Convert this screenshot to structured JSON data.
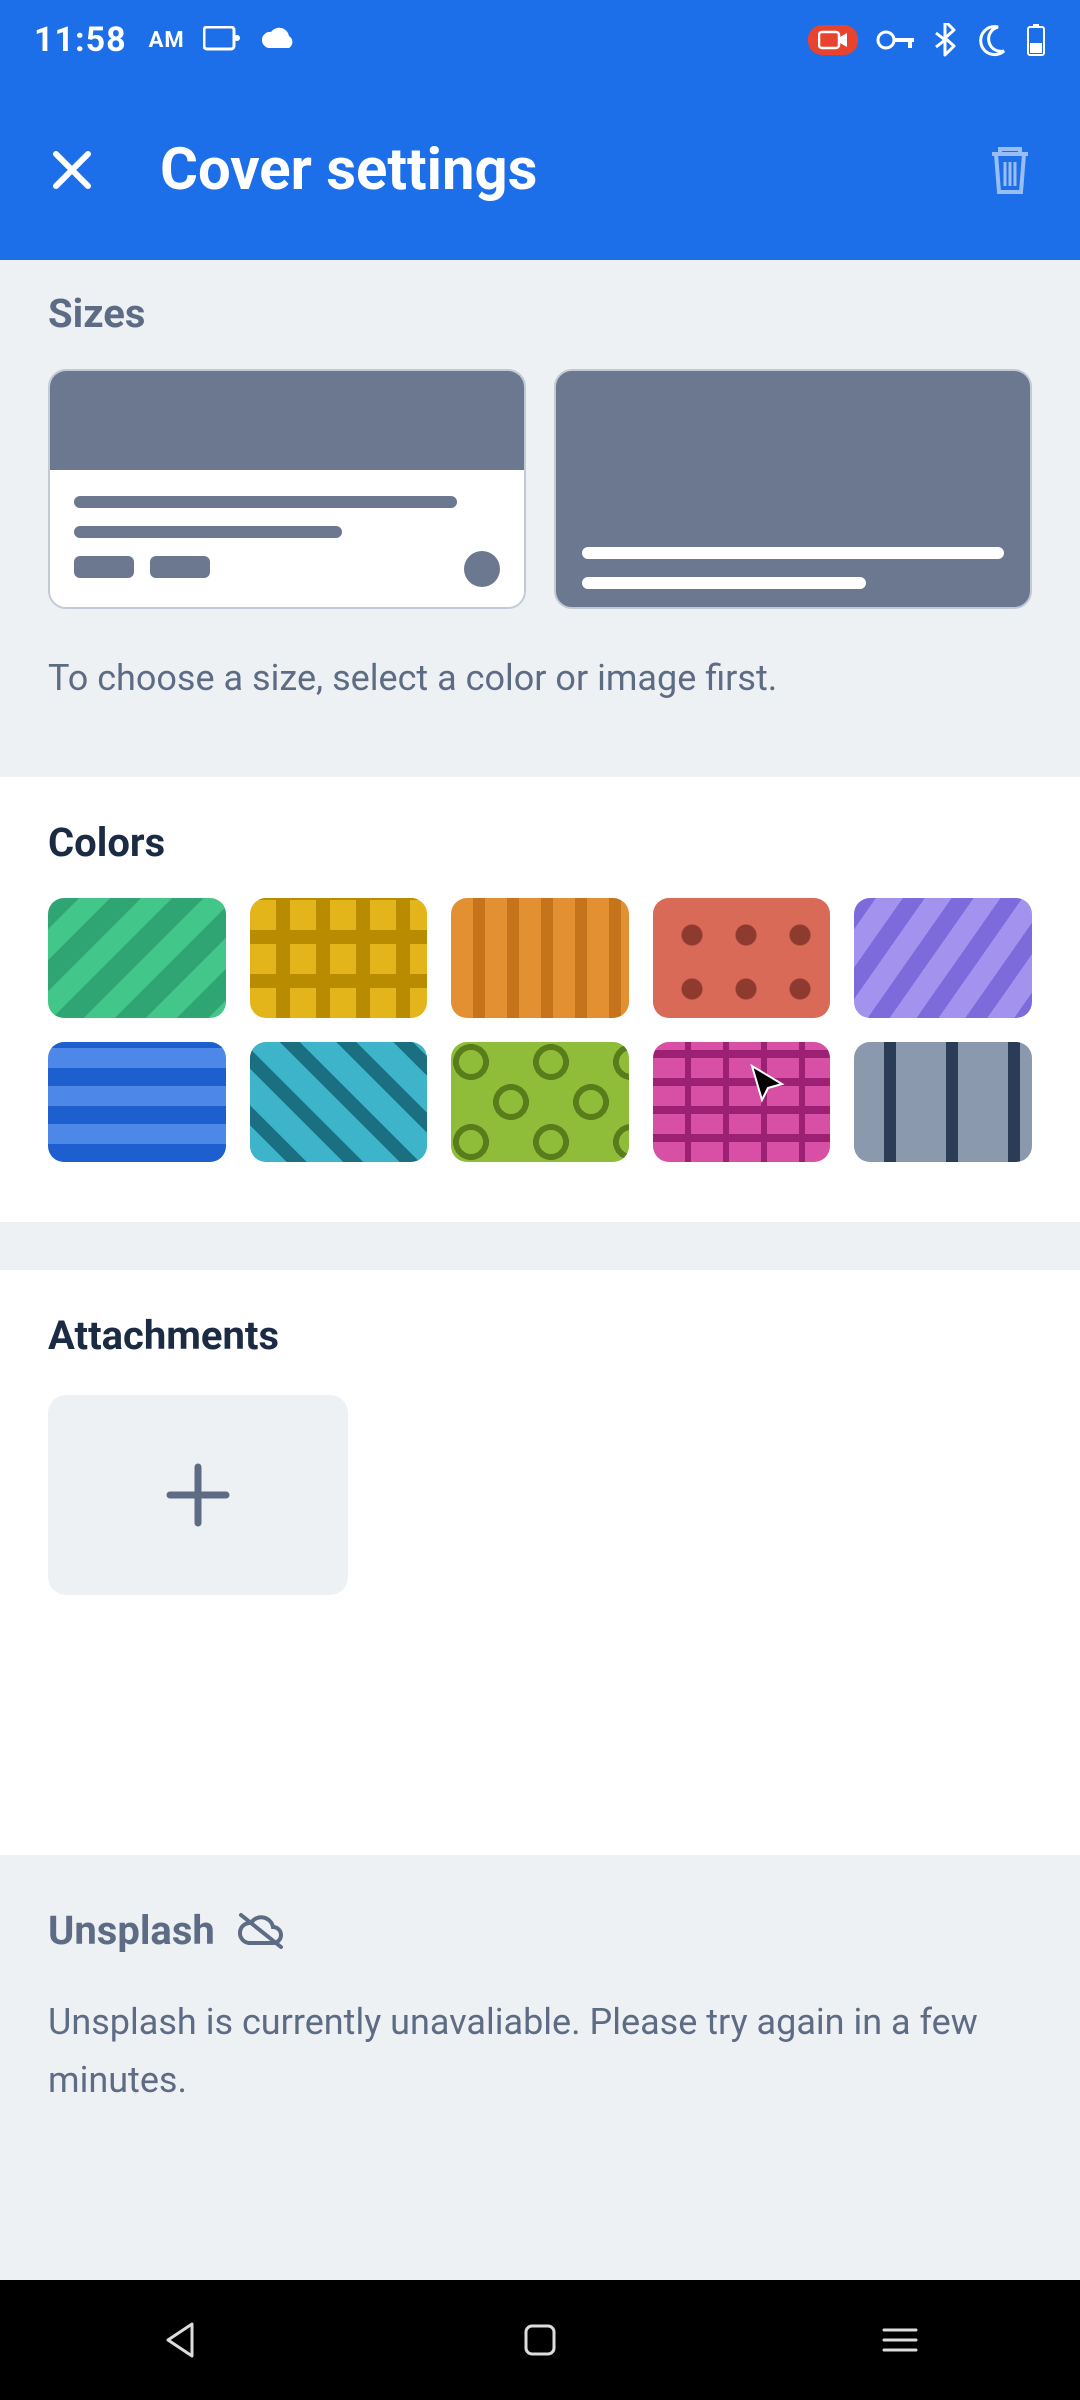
{
  "status": {
    "time": "11:58",
    "ampm": "AM"
  },
  "header": {
    "title": "Cover settings"
  },
  "sizes": {
    "label": "Sizes",
    "hint": "To choose a size, select a color or image first."
  },
  "colors": {
    "label": "Colors",
    "items": [
      "green",
      "yellow",
      "orange",
      "red",
      "purple",
      "blue",
      "teal",
      "lime",
      "pink",
      "slate"
    ]
  },
  "attachments": {
    "label": "Attachments"
  },
  "unsplash": {
    "label": "Unsplash",
    "message": "Unsplash is currently unavaliable. Please try again in a few minutes."
  }
}
